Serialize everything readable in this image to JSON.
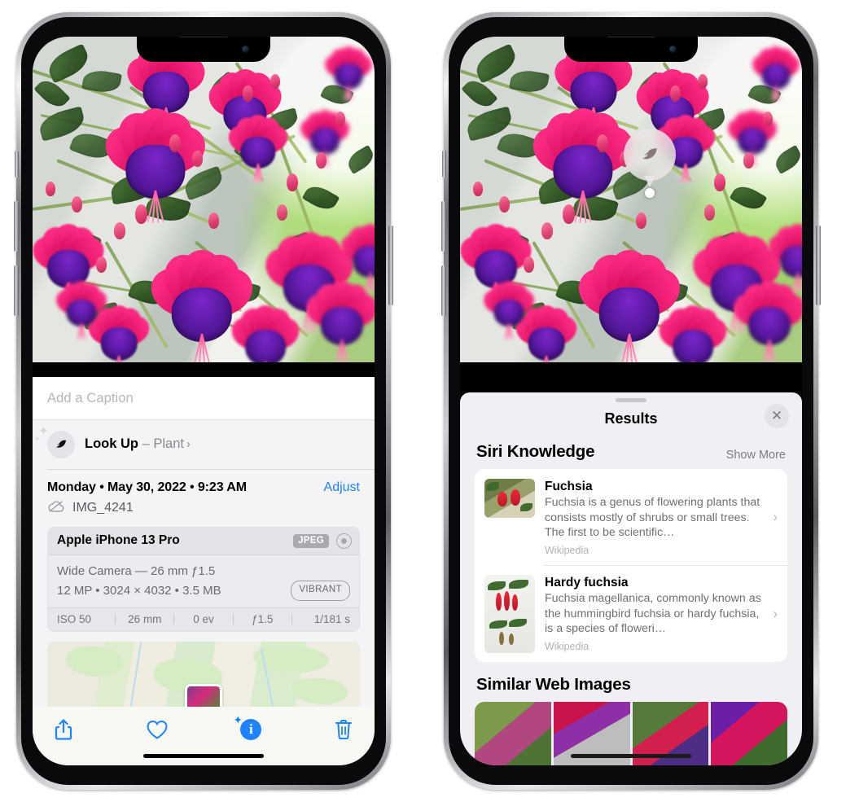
{
  "left_phone": {
    "caption_placeholder": "Add a Caption",
    "lookup": {
      "icon": "leaf-icon",
      "label": "Look Up",
      "dash": " – ",
      "subject": "Plant",
      "chevron": "›"
    },
    "date_text": "Monday • May 30, 2022 • 9:23 AM",
    "adjust_label": "Adjust",
    "file_icon": "cloud-slash-icon",
    "file_name": "IMG_4241",
    "metadata": {
      "device": "Apple iPhone 13 Pro",
      "format_badge": "JPEG",
      "camera_icon": "camera-aperture-icon",
      "lens_line": "Wide Camera — 26 mm ƒ1.5",
      "size_line": "12 MP • 3024 × 4032 • 3.5 MB",
      "style_badge": "VIBRANT",
      "exif": [
        "ISO 50",
        "26 mm",
        "0 ev",
        "ƒ1.5",
        "1/181 s"
      ]
    },
    "toolbar": [
      {
        "name": "share-button",
        "icon": "share-icon"
      },
      {
        "name": "favorite-button",
        "icon": "heart-icon"
      },
      {
        "name": "info-button",
        "icon": "info-sparkle-icon",
        "glyph": "i"
      },
      {
        "name": "delete-button",
        "icon": "trash-icon"
      }
    ]
  },
  "right_phone": {
    "visual_lookup_badge": {
      "icon": "leaf-icon"
    },
    "sheet": {
      "grabber": "drag-handle",
      "title": "Results",
      "close_icon": "close-icon",
      "siri_knowledge": {
        "section_title": "Siri Knowledge",
        "show_more": "Show More",
        "items": [
          {
            "title": "Fuchsia",
            "description": "Fuchsia is a genus of flowering plants that consists mostly of shrubs or small trees. The first to be scientific…",
            "source": "Wikipedia",
            "chevron": "›"
          },
          {
            "title": "Hardy fuchsia",
            "description": "Fuchsia magellanica, commonly known as the hummingbird fuchsia or hardy fuchsia, is a species of floweri…",
            "source": "Wikipedia",
            "chevron": "›"
          }
        ]
      },
      "similar_web_images": {
        "section_title": "Similar Web Images",
        "count": 4
      }
    }
  },
  "colors": {
    "accent_blue": "#1f83ff",
    "panel_gray": "#f4f4f7",
    "sheet_gray": "#f0f0f4",
    "secondary_text": "#6f6f75",
    "card_white": "#ffffff"
  }
}
